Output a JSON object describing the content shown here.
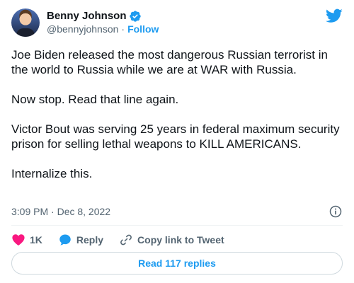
{
  "author": {
    "name": "Benny Johnson",
    "handle": "@bennyjohnson",
    "separator": "·",
    "follow_label": "Follow"
  },
  "tweet": {
    "text": "Joe Biden released the most dangerous Russian terrorist in the world to Russia while we are at WAR with Russia.\n\nNow stop. Read that line again.\n\nVictor Bout was serving 25 years in federal maximum security prison for selling lethal weapons to KILL AMERICANS.\n\nInternalize this.",
    "timestamp": "3:09 PM · Dec 8, 2022"
  },
  "actions": {
    "likes_count": "1K",
    "reply_label": "Reply",
    "copy_link_label": "Copy link to Tweet"
  },
  "read_replies_label": "Read 117 replies",
  "icons": {
    "verified": "verified-badge-icon",
    "logo": "twitter-bird-icon",
    "info": "info-icon",
    "like": "heart-icon",
    "reply": "speech-bubble-icon",
    "link": "link-icon"
  },
  "colors": {
    "accent": "#1d9bf0",
    "heart": "#f91880",
    "text": "#0f1419",
    "secondary": "#536471"
  }
}
